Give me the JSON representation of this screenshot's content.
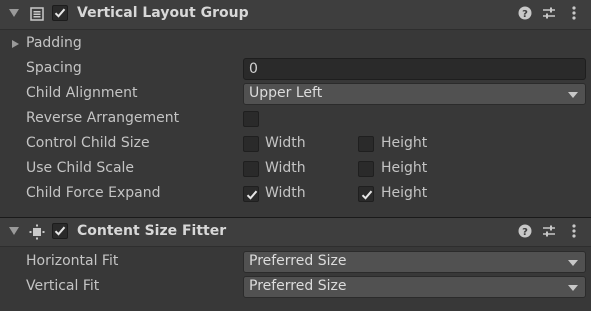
{
  "vertical_layout_group": {
    "title": "Vertical Layout Group",
    "enabled": true,
    "padding_label": "Padding",
    "spacing_label": "Spacing",
    "spacing_value": "0",
    "child_alignment_label": "Child Alignment",
    "child_alignment_value": "Upper Left",
    "reverse_arrangement_label": "Reverse Arrangement",
    "reverse_arrangement_checked": false,
    "control_child_size_label": "Control Child Size",
    "use_child_scale_label": "Use Child Scale",
    "child_force_expand_label": "Child Force Expand",
    "width_label": "Width",
    "height_label": "Height",
    "control_child_size": {
      "width": false,
      "height": false
    },
    "use_child_scale": {
      "width": false,
      "height": false
    },
    "child_force_expand": {
      "width": true,
      "height": true
    }
  },
  "content_size_fitter": {
    "title": "Content Size Fitter",
    "enabled": true,
    "horizontal_fit_label": "Horizontal Fit",
    "horizontal_fit_value": "Preferred Size",
    "vertical_fit_label": "Vertical Fit",
    "vertical_fit_value": "Preferred Size"
  },
  "icons": {
    "help": "help-icon",
    "presets": "presets-icon",
    "more": "kebab-menu-icon",
    "layout_component": "layout-group-icon",
    "fitter_component": "content-size-fitter-icon"
  },
  "colors": {
    "background": "#383838",
    "header": "#3e3e3e",
    "field": "#2a2a2a",
    "dropdown": "#515151",
    "text": "#c4c4c4"
  }
}
